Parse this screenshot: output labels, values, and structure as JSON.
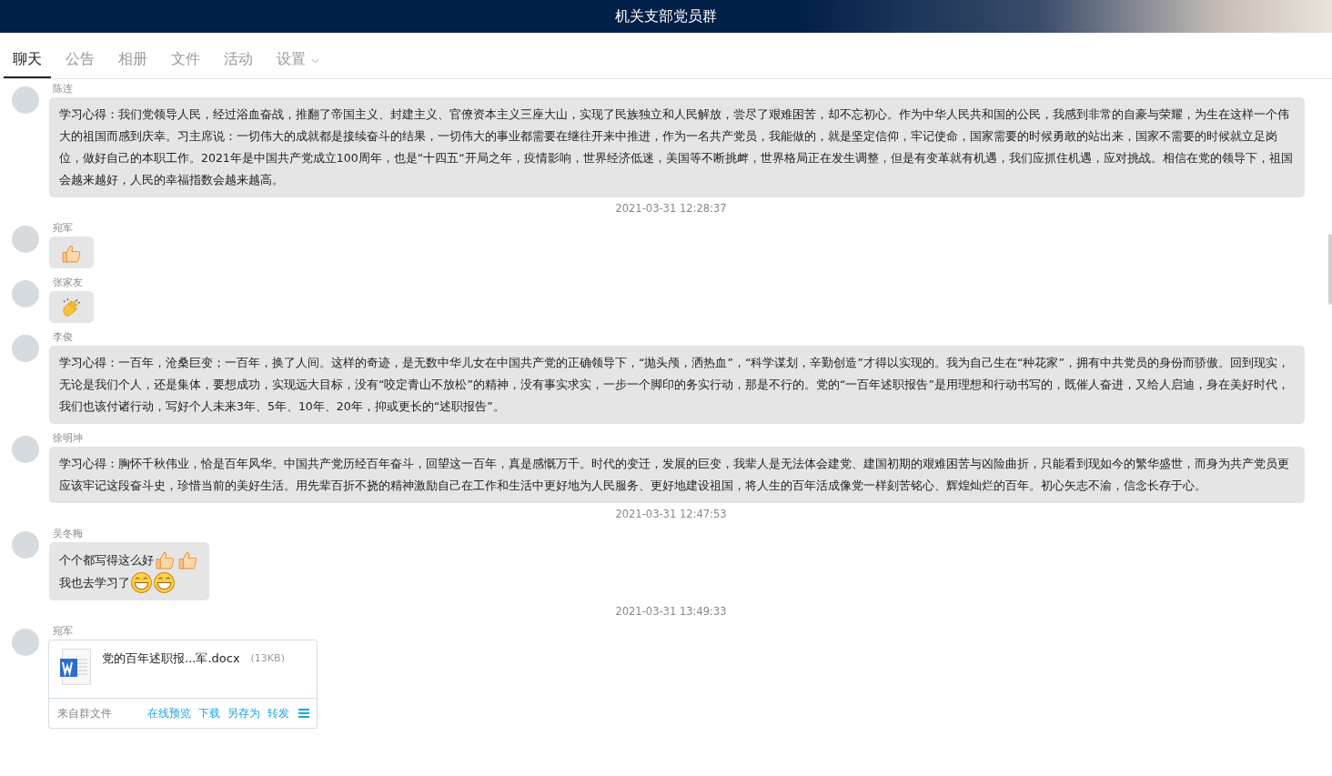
{
  "window": {
    "title": "机关支部党员群"
  },
  "tabs": [
    {
      "label": "聊天",
      "selected": true,
      "dropdown": false
    },
    {
      "label": "公告",
      "selected": false,
      "dropdown": false
    },
    {
      "label": "相册",
      "selected": false,
      "dropdown": false
    },
    {
      "label": "文件",
      "selected": false,
      "dropdown": false
    },
    {
      "label": "活动",
      "selected": false,
      "dropdown": false
    },
    {
      "label": "设置",
      "selected": false,
      "dropdown": true
    }
  ],
  "messages": [
    {
      "kind": "text",
      "sender": "陈连",
      "lines": [
        [
          {
            "kind": "text",
            "text": "学习心得：我们党领导人民，经过浴血奋战，推翻了帝国主义、封建主义、官僚资本主义三座大山，实现了民族独立和人民解放，尝尽了艰难困苦，却不忘初心。作为中华人民共和国的公民，我感到非常的自豪与荣耀，为生在这样一个伟大的祖国而感到庆幸。习主席说：一切伟大的成就都是接续奋斗的结果，一切伟大的事业都需要在继往开来中推进，作为一名共产党员，我能做的，就是坚定信仰，牢记使命，国家需要的时候勇敢的站出来，国家不需要的时候就立足岗位，做好自己的本职工作。2021年是中国共产党成立100周年，也是“十四五“开局之年，疫情影响，世界经济低迷，美国等不断挑衅，世界格局正在发生调整，但是有变革就有机遇，我们应抓住机遇，应对挑战。相信在党的领导下，祖国会越来越好，人民的幸福指数会越来越高。"
          }
        ]
      ]
    },
    {
      "kind": "time",
      "text": "2021-03-31 12:28:37"
    },
    {
      "kind": "sticker",
      "sender": "宛军",
      "lines": [
        [
          {
            "kind": "thumbs"
          }
        ]
      ]
    },
    {
      "kind": "sticker",
      "sender": "张家友",
      "lines": [
        [
          {
            "kind": "clap"
          }
        ]
      ]
    },
    {
      "kind": "text",
      "sender": "李俊",
      "lines": [
        [
          {
            "kind": "text",
            "text": "学习心得：一百年，沧桑巨变；一百年，换了人间。这样的奇迹，是无数中华儿女在中国共产党的正确领导下，“抛头颅，洒热血”，“科学谋划，辛勤创造”才得以实现的。我为自己生在“种花家”，拥有中共党员的身份而骄傲。回到现实，无论是我们个人，还是集体，要想成功，实现远大目标，没有“咬定青山不放松”的精神，没有事实求实，一步一个脚印的务实行动，那是不行的。党的“一百年述职报告”是用理想和行动书写的，既催人奋进，又给人启迪，身在美好时代，我们也该付诸行动，写好个人未来3年、5年、10年、20年，抑或更长的“述职报告”。"
          }
        ]
      ]
    },
    {
      "kind": "text",
      "sender": "徐明坤",
      "lines": [
        [
          {
            "kind": "text",
            "text": "学习心得：胸怀千秋伟业，恰是百年风华。中国共产党历经百年奋斗，回望这一百年，真是感慨万千。时代的变迁，发展的巨变，我辈人是无法体会建党、建国初期的艰难困苦与凶险曲折，只能看到现如今的繁华盛世，而身为共产党员更应该牢记这段奋斗史，珍惜当前的美好生活。用先辈百折不挠的精神激励自己在工作和生活中更好地为人民服务、更好地建设祖国，将人生的百年活成像党一样刻苦铭心、辉煌灿烂的百年。初心矢志不渝，信念长存于心。"
          }
        ]
      ]
    },
    {
      "kind": "time",
      "text": "2021-03-31 12:47:53"
    },
    {
      "kind": "text",
      "sender": "吴冬梅",
      "lines": [
        [
          {
            "kind": "text",
            "text": "个个都写得这么好"
          },
          {
            "kind": "thumbs"
          },
          {
            "kind": "thumbs"
          }
        ],
        [
          {
            "kind": "text",
            "text": "我也去学习了"
          },
          {
            "kind": "grin"
          },
          {
            "kind": "grin"
          }
        ]
      ]
    },
    {
      "kind": "time",
      "text": "2021-03-31 13:49:33"
    },
    {
      "kind": "file",
      "sender": "宛军",
      "file_name": "党的百年述职报...军.docx",
      "size": "(13KB)",
      "source": "来自群文件",
      "actions": [
        "在线预览",
        "下载",
        "另存为",
        "转发"
      ]
    }
  ]
}
